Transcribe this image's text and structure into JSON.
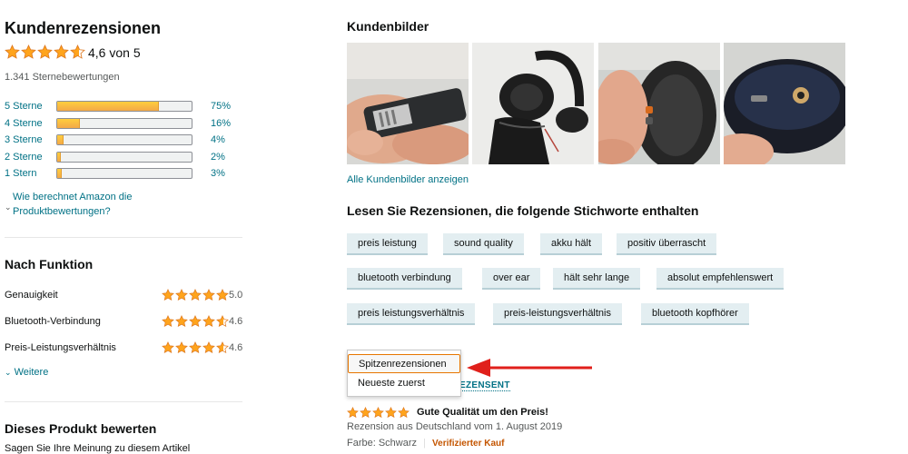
{
  "left": {
    "title": "Kundenrezensionen",
    "rating_text": "4,6 von 5",
    "rating_value": 4.6,
    "total_ratings": "1.341 Sternebewertungen",
    "histogram": [
      {
        "label": "5 Sterne",
        "pct_text": "75%",
        "pct": 75
      },
      {
        "label": "4 Sterne",
        "pct_text": "16%",
        "pct": 16
      },
      {
        "label": "3 Sterne",
        "pct_text": "4%",
        "pct": 4
      },
      {
        "label": "2 Sterne",
        "pct_text": "2%",
        "pct": 2
      },
      {
        "label": "1 Stern",
        "pct_text": "3%",
        "pct": 3
      }
    ],
    "how_calculated_line1": "Wie berechnet Amazon die",
    "how_calculated_line2": "Produktbewertungen?",
    "by_feature_title": "Nach Funktion",
    "features": [
      {
        "name": "Genauigkeit",
        "value_text": "5.0",
        "value": 5.0
      },
      {
        "name": "Bluetooth-Verbindung",
        "value_text": "4.6",
        "value": 4.6
      },
      {
        "name": "Preis-Leistungsverhältnis",
        "value_text": "4.6",
        "value": 4.6
      }
    ],
    "more_label": "Weitere",
    "rate_title": "Dieses Produkt bewerten",
    "rate_subtitle": "Sagen Sie Ihre Meinung zu diesem Artikel"
  },
  "right": {
    "images_title": "Kundenbilder",
    "images": [
      {
        "icon": "photo-usb-cable-in-hand"
      },
      {
        "icon": "photo-headphones-with-pouch"
      },
      {
        "icon": "photo-headphone-buttons"
      },
      {
        "icon": "photo-headphone-port"
      }
    ],
    "all_images_link": "Alle Kundenbilder anzeigen",
    "keywords_title": "Lesen Sie Rezensionen, die folgende Stichworte enthalten",
    "keywords": [
      [
        "preis leistung",
        "sound quality",
        "akku hält",
        "positiv überrascht"
      ],
      [
        "bluetooth verbindung",
        "over ear",
        "hält sehr lange",
        "absolut empfehlenswert"
      ],
      [
        "preis leistungsverhältnis",
        "preis-leistungsverhältnis",
        "bluetooth kopfhörer"
      ]
    ],
    "sort_options": [
      "Spitzenrezensionen",
      "Neueste zuerst"
    ],
    "sort_selected": "Spitzenrezensionen",
    "hidden_link_fragment": "EZENSENT",
    "arrow_color": "#e0201b",
    "review": {
      "stars": 5,
      "title": "Gute Qualität um den Preis!",
      "meta": "Rezension aus Deutschland vom 1. August 2019",
      "color": "Farbe: Schwarz",
      "separator": "|",
      "verified": "Verifizierter Kauf"
    }
  },
  "colors": {
    "link": "#007185",
    "star": "#ffa41c",
    "verified": "#c45500",
    "chip": "#e3eef1"
  }
}
